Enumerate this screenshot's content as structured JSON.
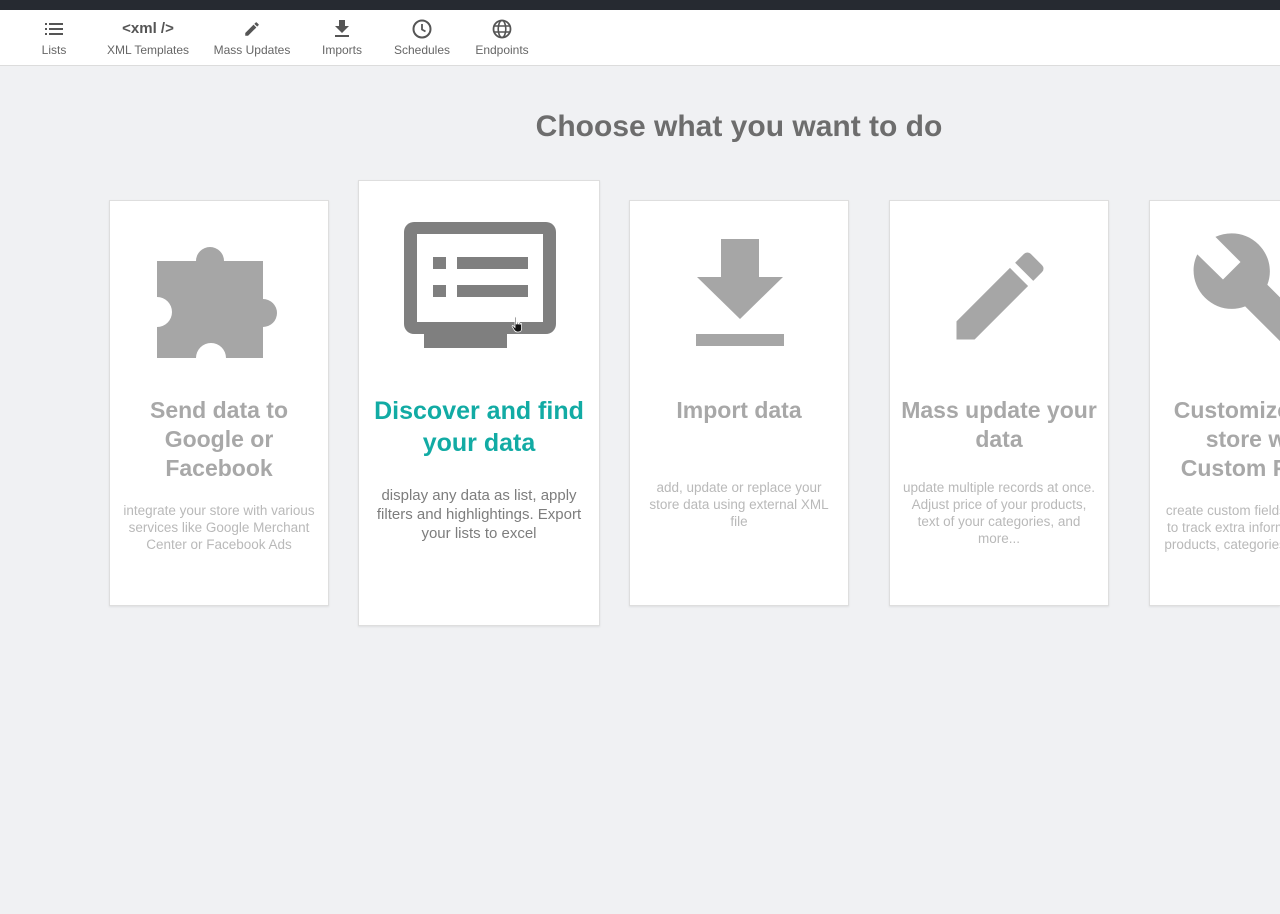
{
  "nav": {
    "items": [
      {
        "label": "Lists",
        "icon": "list-icon"
      },
      {
        "label": "XML Templates",
        "icon_text": "<xml />"
      },
      {
        "label": "Mass Updates",
        "icon": "pencil-icon"
      },
      {
        "label": "Imports",
        "icon": "download-icon"
      },
      {
        "label": "Schedules",
        "icon": "clock-icon"
      },
      {
        "label": "Endpoints",
        "icon": "globe-icon"
      }
    ]
  },
  "page": {
    "title": "Choose what you want to do"
  },
  "cards": [
    {
      "title": "Send data to Google or Facebook",
      "description": "integrate your store with various services like Google Merchant Center or Facebook Ads",
      "icon": "puzzle-icon"
    },
    {
      "title": "Discover and find your data",
      "description": "display any data as list, apply filters and highlightings. Export your lists to excel",
      "icon": "monitor-list-icon"
    },
    {
      "title": "Import data",
      "description": "add, update or replace your store data using external XML file",
      "icon": "download-icon"
    },
    {
      "title": "Mass update your data",
      "description": "update multiple records at once. Adjust price of your products, text of your categories, and more...",
      "icon": "pencil-icon"
    },
    {
      "title": "Customize your store with Custom Fields",
      "description": "create custom fields for records to track extra information about products, categories, customers",
      "icon": "wrench-icon"
    }
  ],
  "colors": {
    "accent": "#12aba4",
    "topbar": "#262a31",
    "icon_gray": "#a6a6a6",
    "icon_active": "#7f7f7f"
  }
}
